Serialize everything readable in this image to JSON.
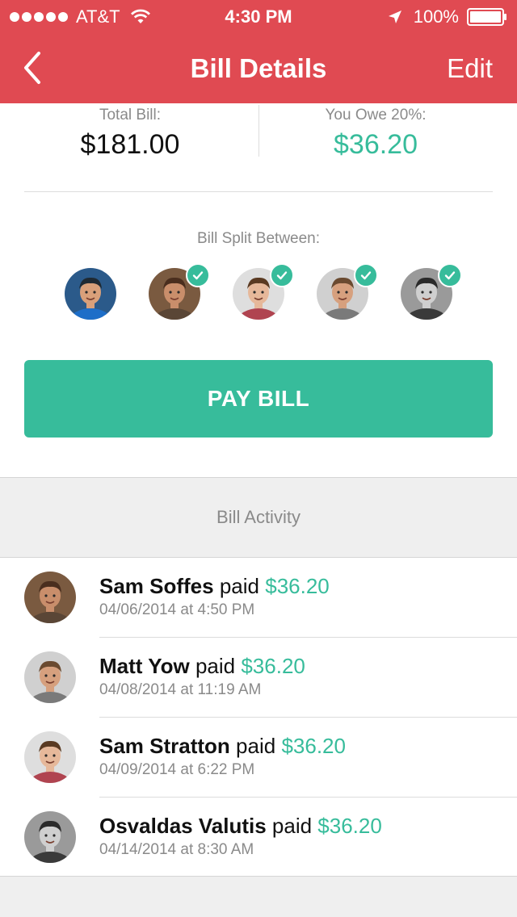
{
  "status_bar": {
    "carrier": "AT&T",
    "time": "4:30 PM",
    "battery": "100%"
  },
  "nav": {
    "title": "Bill Details",
    "edit_label": "Edit",
    "back_icon": "chevron-left-icon"
  },
  "totals": {
    "total_label": "Total Bill:",
    "total_value": "$181.00",
    "owe_label": "You Owe 20%:",
    "owe_value": "$36.20"
  },
  "split": {
    "label": "Bill Split Between:",
    "people": [
      {
        "avatar": "person-1",
        "paid": false,
        "skin": "#d9a07a",
        "hair": "#1f2a33",
        "shirt": "#1e6ec8",
        "bg": "#2b5a8a"
      },
      {
        "avatar": "person-2",
        "paid": true,
        "skin": "#c98e6b",
        "hair": "#4a2e1e",
        "shirt": "#5a4636",
        "bg": "#7a5a40"
      },
      {
        "avatar": "person-3",
        "paid": true,
        "skin": "#e6b89a",
        "hair": "#5a3a22",
        "shirt": "#b04450",
        "bg": "#dedede"
      },
      {
        "avatar": "person-4",
        "paid": true,
        "skin": "#d6a07e",
        "hair": "#6a4a30",
        "shirt": "#7a7a7a",
        "bg": "#d0d0d0"
      },
      {
        "avatar": "person-5",
        "paid": true,
        "skin": "#cfcfcf",
        "hair": "#2a2a2a",
        "shirt": "#3a3a3a",
        "bg": "#9a9a9a"
      }
    ]
  },
  "pay_button": "PAY BILL",
  "activity": {
    "header": "Bill Activity",
    "items": [
      {
        "name": "Sam Soffes",
        "verb": "paid",
        "amount": "$36.20",
        "date": "04/06/2014 at 4:50 PM",
        "skin": "#c98e6b",
        "hair": "#4a2e1e",
        "shirt": "#5a4636",
        "bg": "#7a5a40"
      },
      {
        "name": "Matt Yow",
        "verb": "paid",
        "amount": "$36.20",
        "date": "04/08/2014 at 11:19 AM",
        "skin": "#d6a07e",
        "hair": "#6a4a30",
        "shirt": "#7a7a7a",
        "bg": "#d0d0d0"
      },
      {
        "name": "Sam Stratton",
        "verb": "paid",
        "amount": "$36.20",
        "date": "04/09/2014 at 6:22 PM",
        "skin": "#e6b89a",
        "hair": "#5a3a22",
        "shirt": "#b04450",
        "bg": "#dedede"
      },
      {
        "name": "Osvaldas Valutis",
        "verb": "paid",
        "amount": "$36.20",
        "date": "04/14/2014 at 8:30 AM",
        "skin": "#cfcfcf",
        "hair": "#2a2a2a",
        "shirt": "#3a3a3a",
        "bg": "#9a9a9a"
      }
    ]
  },
  "colors": {
    "header": "#e04a52",
    "accent": "#37bc9b",
    "muted_text": "#8a8a8a"
  }
}
